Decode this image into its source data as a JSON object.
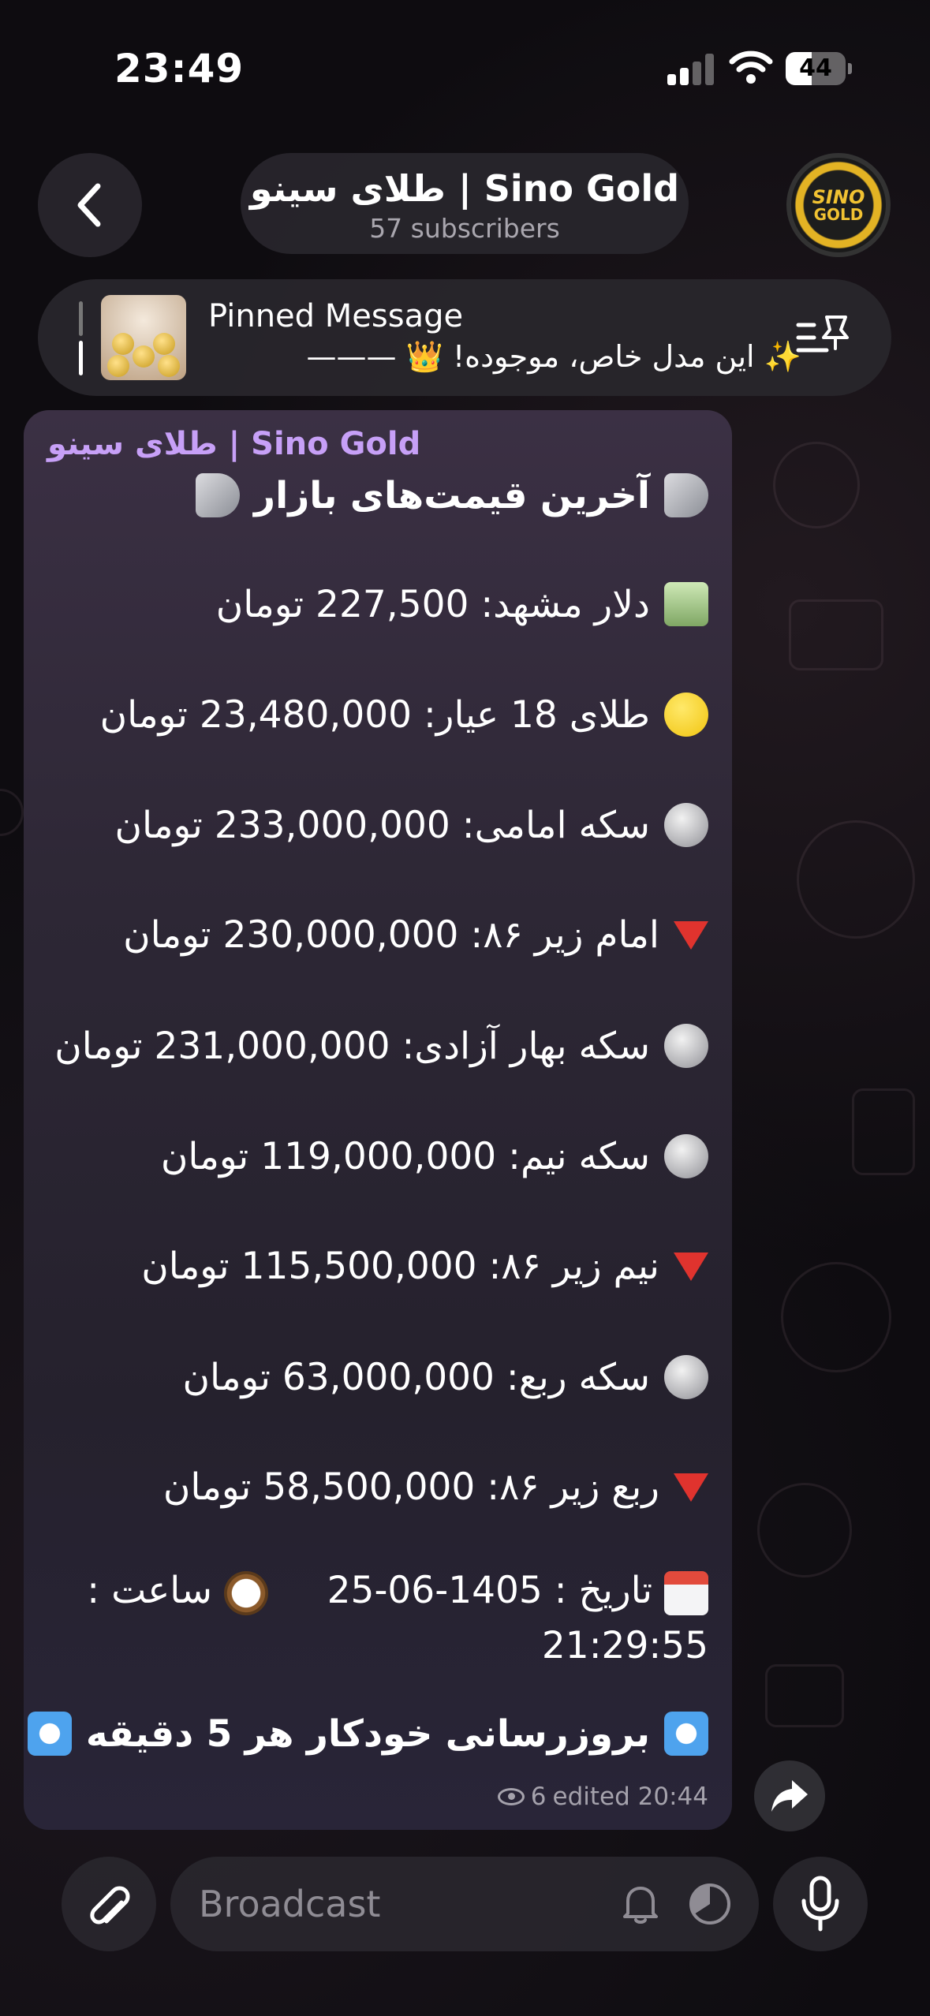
{
  "status_bar": {
    "time": "23:49",
    "battery": "44",
    "battery_level": 0.44
  },
  "header": {
    "title": "طلای سینو | Sino Gold",
    "subtitle": "57 subscribers",
    "avatar_line1": "SINO",
    "avatar_line2": "GOLD"
  },
  "pinned": {
    "label": "Pinned Message",
    "text": "✨ این مدل خاص، موجوده! 👑 ———"
  },
  "message": {
    "sender": "طلای سینو | Sino Gold",
    "heading": "آخرین قیمت‌های بازار",
    "prices": [
      {
        "icon": "money-icon",
        "text": "دلار مشهد: 227,500 تومان"
      },
      {
        "icon": "gold-circle-icon",
        "text": "طلای 18 عیار: 23,480,000 تومان"
      },
      {
        "icon": "coin-icon",
        "text": "سکه امامی: 233,000,000 تومان"
      },
      {
        "icon": "down-triangle-icon",
        "text": "امام زیر ۸۶: 230,000,000 تومان"
      },
      {
        "icon": "coin-icon",
        "text": "سکه بهار آزادی: 231,000,000 تومان"
      },
      {
        "icon": "coin-icon",
        "text": "سکه نیم: 119,000,000 تومان"
      },
      {
        "icon": "down-triangle-icon",
        "text": "نیم زیر ۸۶: 115,500,000 تومان"
      },
      {
        "icon": "coin-icon",
        "text": "سکه ربع: 63,000,000 تومان"
      },
      {
        "icon": "down-triangle-icon",
        "text": "ربع زیر ۸۶: 58,500,000 تومان"
      }
    ],
    "date_text": "تاریخ : 1405-06-25",
    "time_text": "ساعت : 21:29:55",
    "footer": "بروزرسانی خودکار هر 5 دقیقه",
    "views": "6",
    "edited": "edited 20:44"
  },
  "composer": {
    "placeholder": "Broadcast"
  },
  "colors": {
    "sender": "#c7a0f7",
    "bubble": "#2d2735",
    "accent_gold": "#f1c232"
  }
}
